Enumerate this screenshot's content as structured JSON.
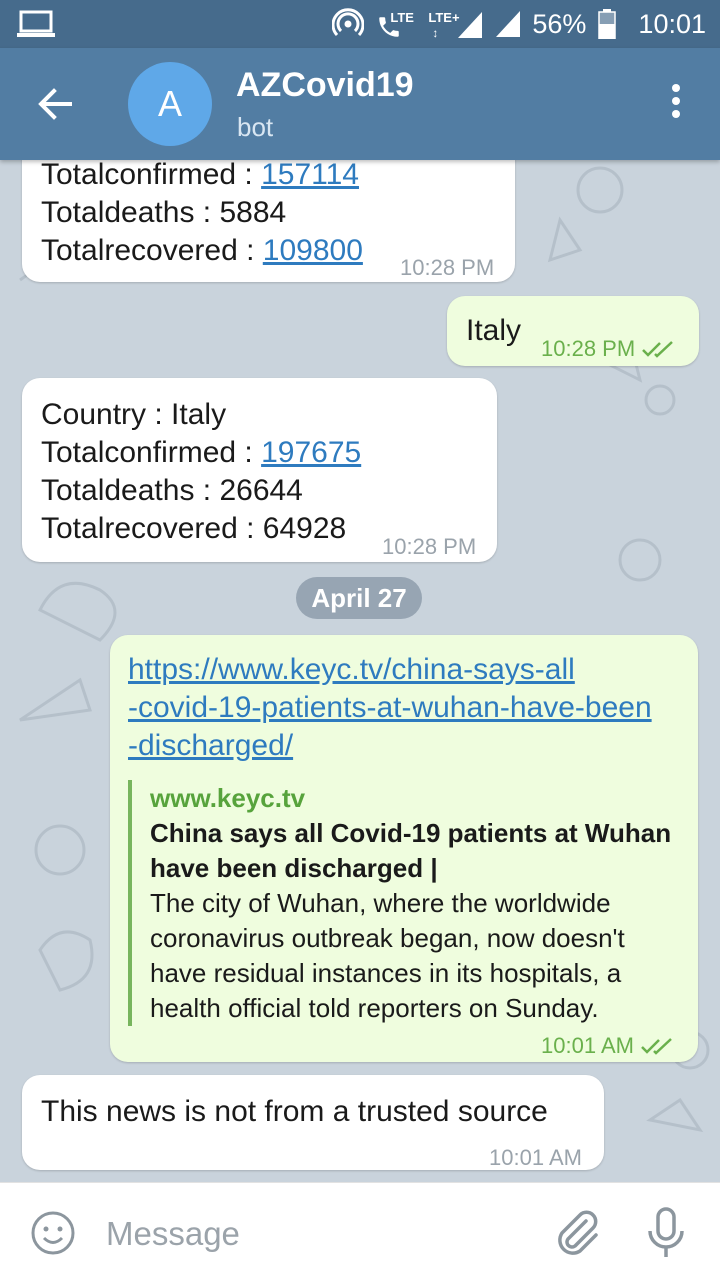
{
  "status_bar": {
    "network_lte1": "LTE",
    "network_lte2": "LTE+",
    "battery": "56%",
    "clock": "10:01"
  },
  "header": {
    "avatar_letter": "A",
    "title": "AZCovid19",
    "subtitle": "bot"
  },
  "messages": {
    "msg1": {
      "lines": [
        "Totalconfirmed : ",
        "157114",
        "Totaldeaths : 5884",
        "Totalrecovered : ",
        "109800"
      ],
      "time": "10:28 PM"
    },
    "msg2": {
      "text": "Italy",
      "time": "10:28 PM"
    },
    "msg3": {
      "country": "Country : Italy",
      "confirmed_label": "Totalconfirmed : ",
      "confirmed_value": "197675",
      "deaths": "Totaldeaths : 26644",
      "recovered": "Totalrecovered : 64928",
      "time": "10:28 PM"
    },
    "date_separator": "April 27",
    "msg4": {
      "link_line1": "https://www.keyc.tv/china-says-all",
      "link_line2": "-covid-19-patients-at-wuhan-have-been",
      "link_line3": "-discharged/",
      "preview_site": "www.keyc.tv",
      "preview_title_1": "China says all Covid-19 patients at Wuhan",
      "preview_title_2": "have been discharged |",
      "preview_desc_1": "The city of Wuhan, where the worldwide",
      "preview_desc_2": "coronavirus outbreak began, now doesn't",
      "preview_desc_3": "have residual instances in its hospitals, a",
      "preview_desc_4": "health official told reporters on Sunday.",
      "time": "10:01 AM"
    },
    "msg5": {
      "text": "This news is not from a trusted source",
      "time": "10:01 AM"
    }
  },
  "input": {
    "placeholder": "Message"
  },
  "colors": {
    "status_bar": "#466b8c",
    "app_bar": "#527da3",
    "chat_bg": "#c9d3dc",
    "outgoing_bubble": "#effdde",
    "incoming_bubble": "#ffffff",
    "link": "#2e7bbf",
    "read_check": "#6ab04c"
  },
  "icons": [
    "laptop-icon",
    "hotspot-icon",
    "call-lte-icon",
    "signal-icon",
    "battery-icon",
    "back-arrow-icon",
    "more-vert-icon",
    "emoji-icon",
    "attach-icon",
    "mic-icon",
    "double-check-icon"
  ]
}
